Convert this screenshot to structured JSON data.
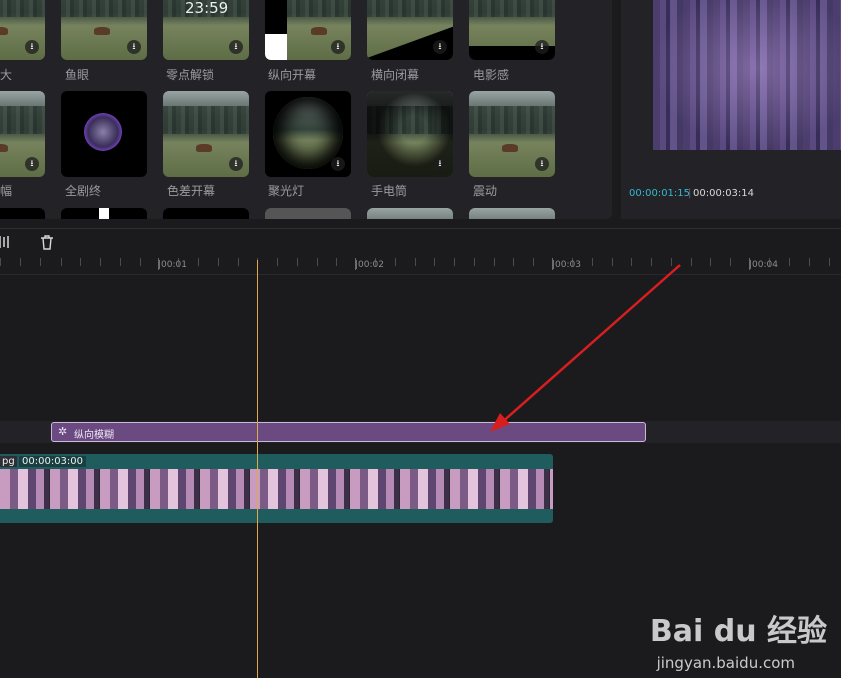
{
  "effects_panel": {
    "row1": [
      {
        "label": "大"
      },
      {
        "label": "鱼眼"
      },
      {
        "label": "零点解锁",
        "overlay_time": "23:59"
      },
      {
        "label": "纵向开幕"
      },
      {
        "label": "横向闭幕"
      },
      {
        "label": "电影感"
      }
    ],
    "row2": [
      {
        "label": "幅"
      },
      {
        "label": "全剧终"
      },
      {
        "label": "色差开幕"
      },
      {
        "label": "聚光灯"
      },
      {
        "label": "手电筒"
      },
      {
        "label": "震动"
      }
    ],
    "download_glyph": "⭳"
  },
  "preview": {
    "current_time": "00:00:01:15",
    "separator": "|",
    "total_time": "00:00:03:14",
    "current_color": "#34b7d4"
  },
  "toolbar": {
    "split_icon": "split-icon",
    "delete_icon": "trash-icon"
  },
  "ruler": {
    "labels": [
      "|00:01",
      "|00:02",
      "|00:03",
      "|00:04"
    ]
  },
  "timeline": {
    "effect_clip": {
      "name": "纵向模糊",
      "color": "#6b4a82"
    },
    "video_clip": {
      "file_suffix": "pg",
      "duration": "00:00:03:00",
      "color": "#1e5c5e"
    },
    "playhead_color": "#e0a848"
  },
  "annotation": {
    "arrow_color": "#d81e1e"
  },
  "watermark": {
    "brand": "Bai du 经验",
    "url": "jingyan.baidu.com"
  }
}
